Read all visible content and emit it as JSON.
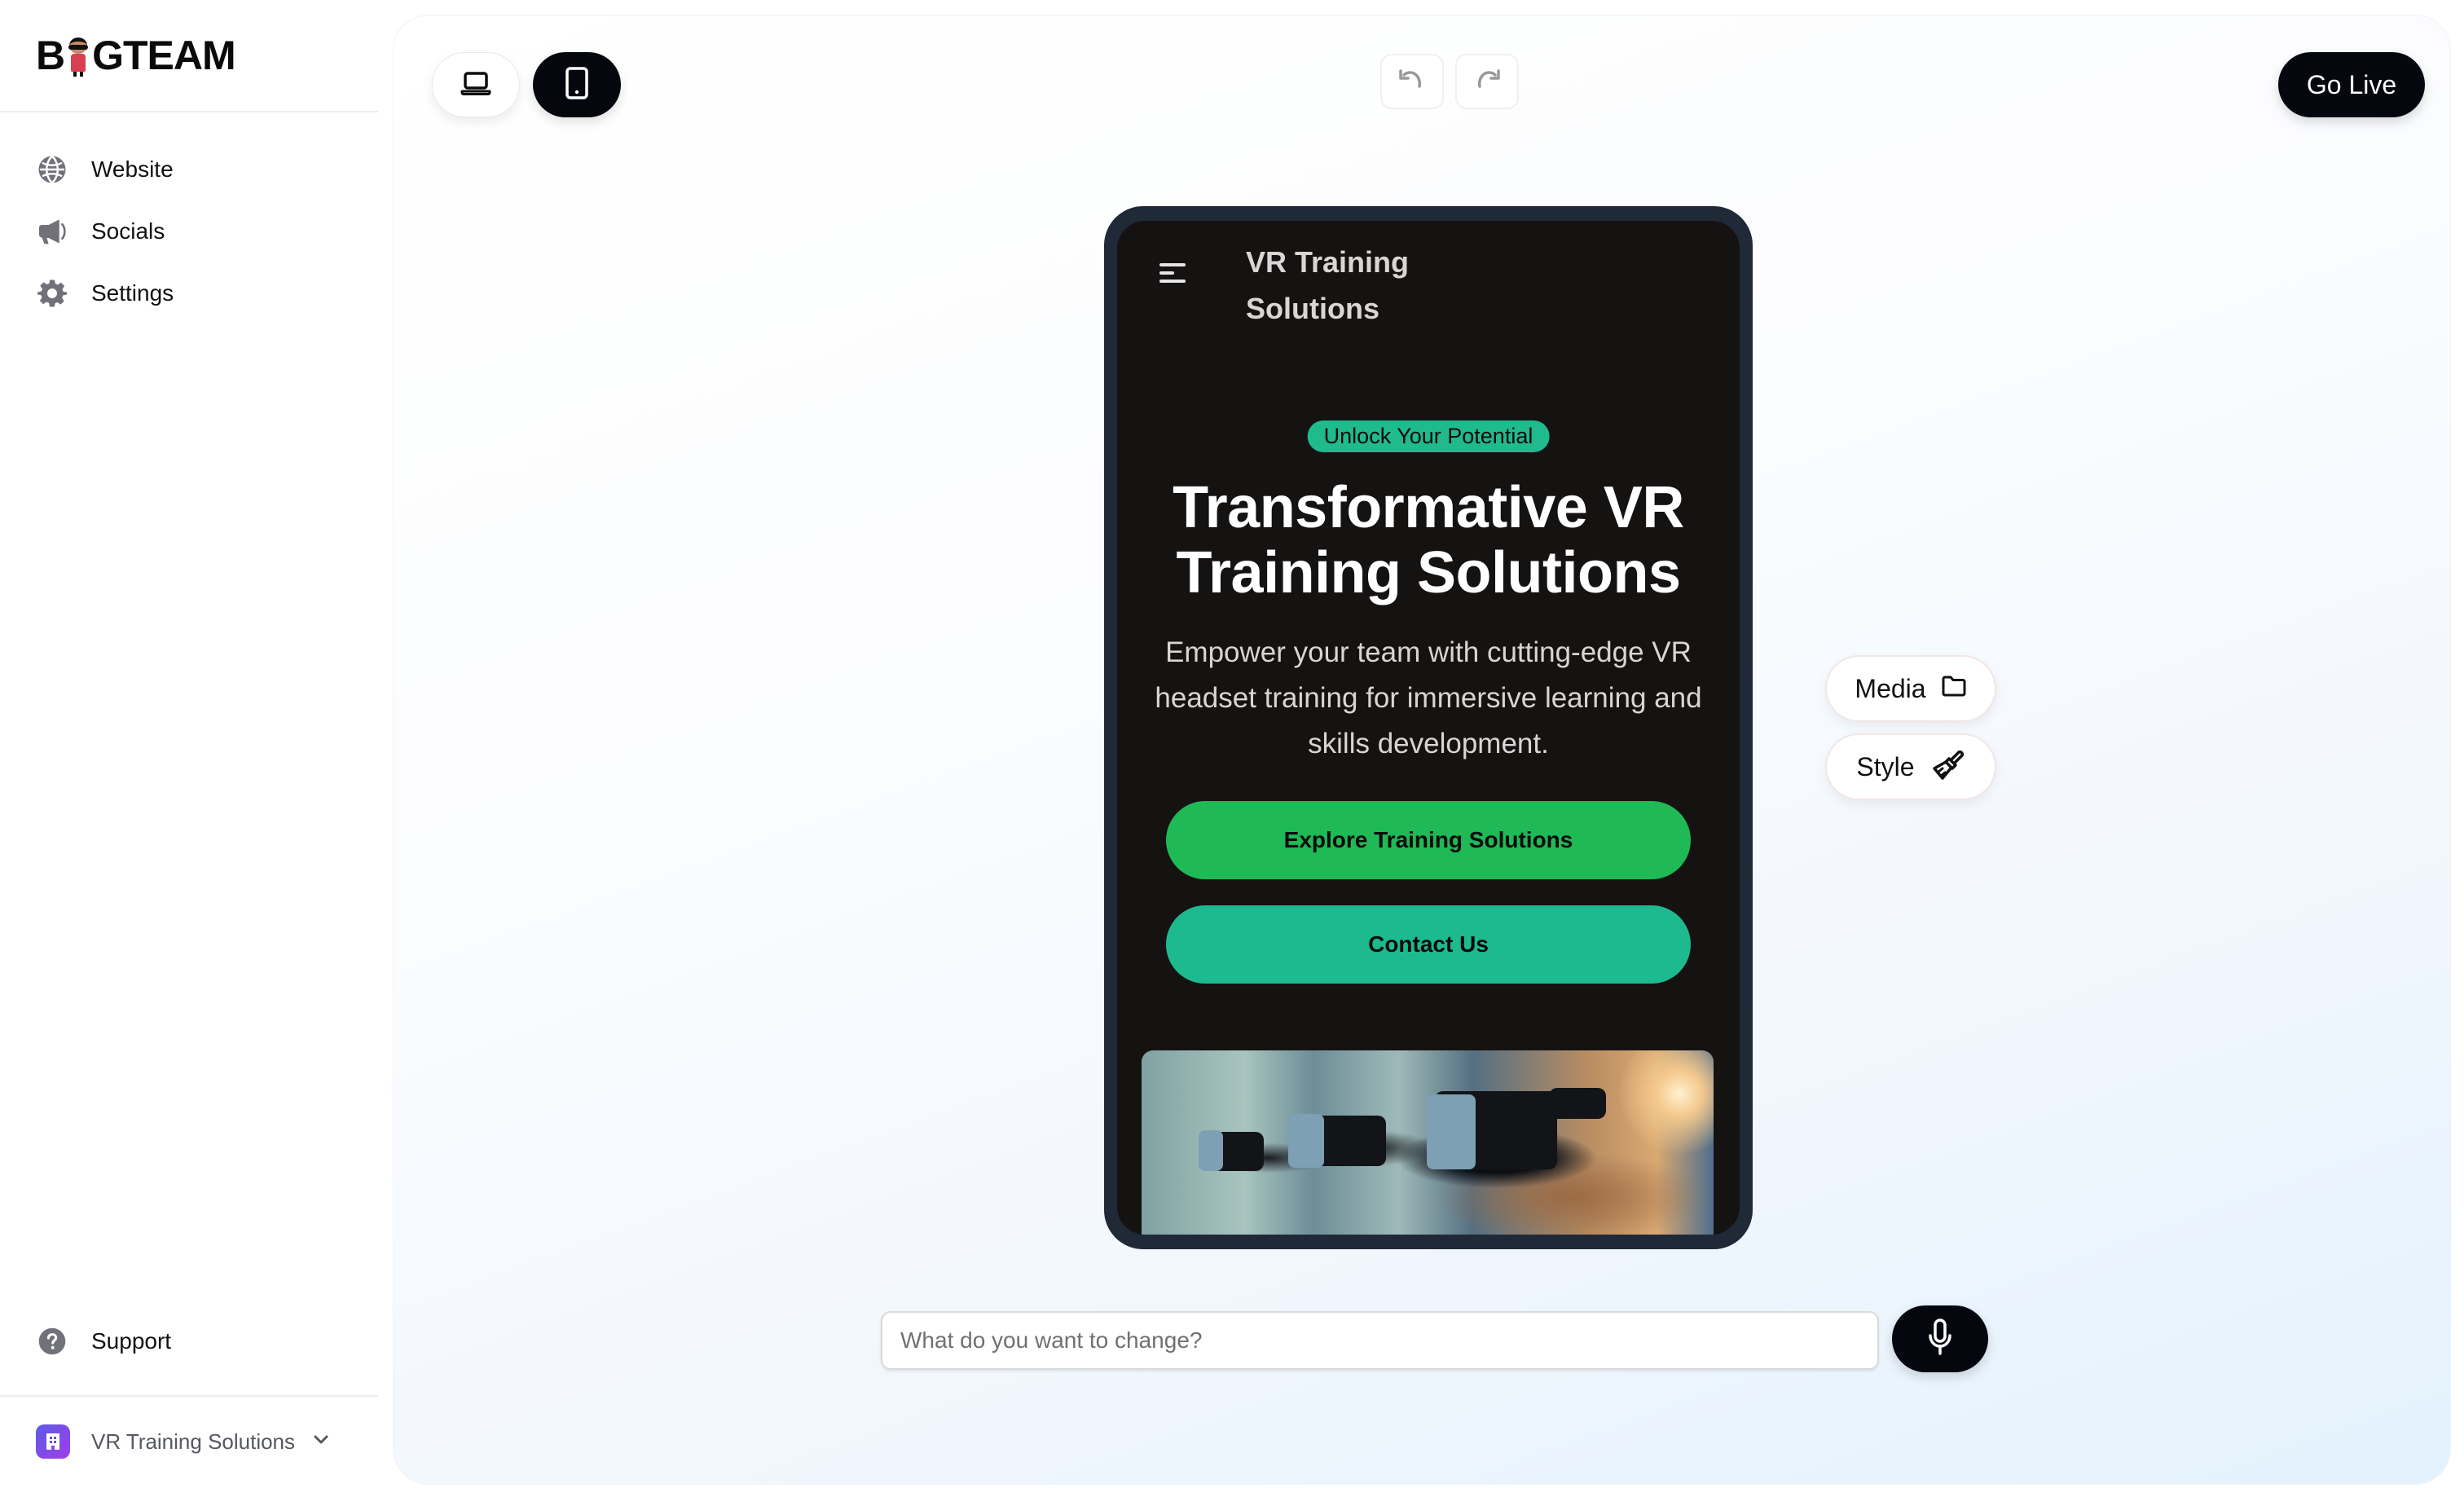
{
  "app": {
    "logo_text_before": "B",
    "logo_text_after": "GTEAM",
    "logo_alt": "BIGTEAM"
  },
  "sidebar": {
    "items": [
      {
        "label": "Website",
        "icon": "globe-icon"
      },
      {
        "label": "Socials",
        "icon": "megaphone-icon"
      },
      {
        "label": "Settings",
        "icon": "gear-icon"
      }
    ],
    "support": {
      "label": "Support",
      "icon": "question-circle-icon"
    },
    "workspace": {
      "label": "VR Training Solutions",
      "icon": "building-icon",
      "chevron": "chevron-down-icon"
    }
  },
  "toolbar": {
    "device_modes": [
      {
        "name": "desktop",
        "icon": "laptop-icon",
        "active": false
      },
      {
        "name": "mobile",
        "icon": "phone-icon",
        "active": true
      }
    ],
    "undo_icon": "undo-icon",
    "redo_icon": "redo-icon",
    "go_live_label": "Go Live"
  },
  "preview": {
    "site_title": "VR Training Solutions",
    "badge": "Unlock Your Potential",
    "hero_title": "Transformative VR Training Solutions",
    "hero_subtitle": "Empower your team with cutting-edge VR headset training for immersive learning and skills development.",
    "primary_cta": "Explore Training Solutions",
    "secondary_cta": "Contact Us",
    "image_alt": "People wearing VR headsets during training",
    "colors": {
      "background": "#151212",
      "badge": "#1fba8e",
      "primary_cta": "#1fb955",
      "secondary_cta": "#1dba8f",
      "device_frame": "#1f2937"
    }
  },
  "tools": {
    "media_label": "Media",
    "media_icon": "folder-icon",
    "style_label": "Style",
    "style_icon": "paintbrush-icon"
  },
  "prompt": {
    "value": "",
    "placeholder": "What do you want to change?",
    "mic_icon": "microphone-icon"
  }
}
